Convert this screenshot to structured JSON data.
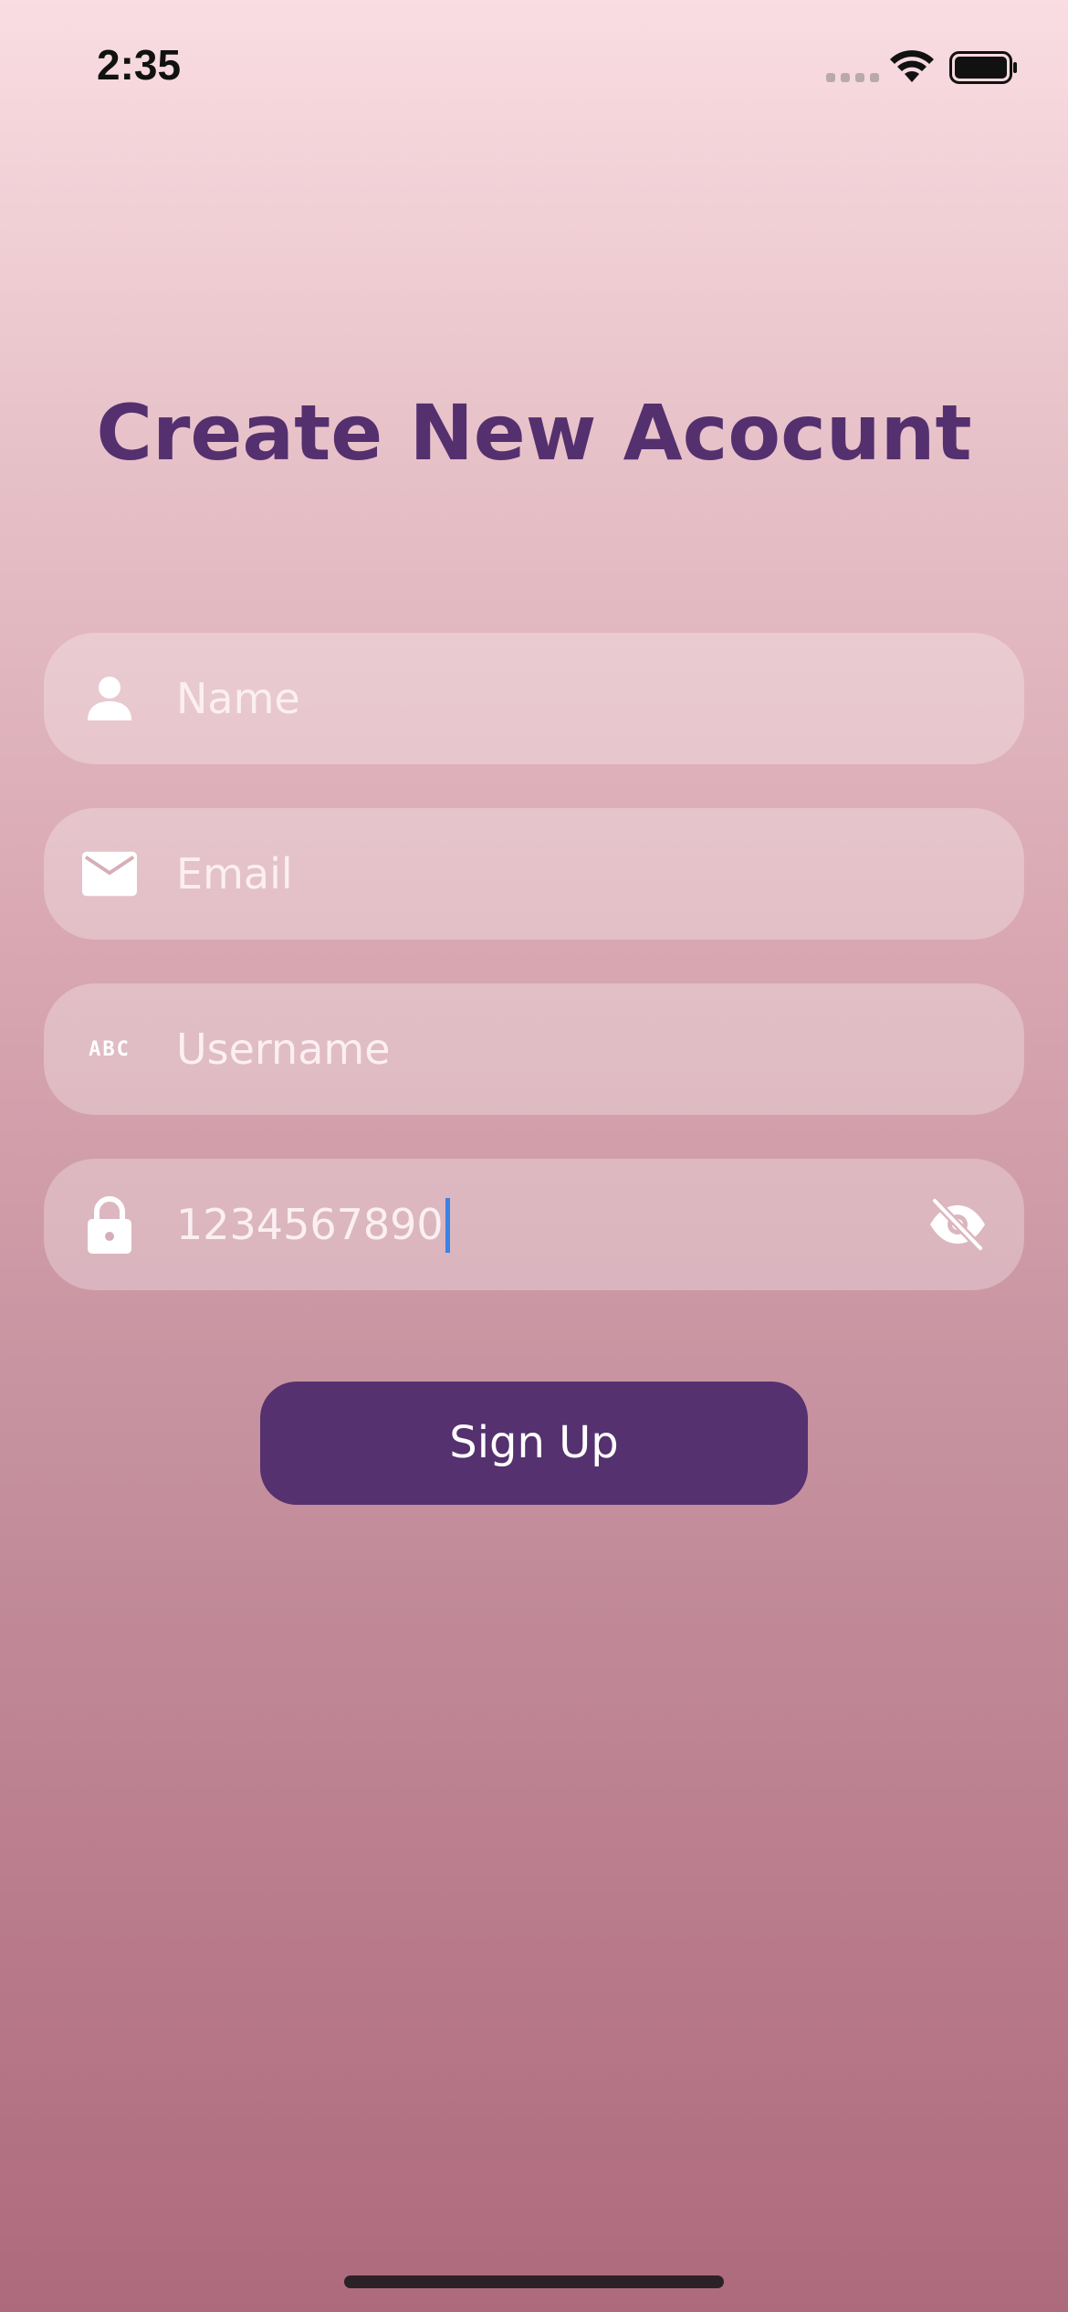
{
  "status_bar": {
    "time": "2:35"
  },
  "title": "Create New Acocunt",
  "form": {
    "name": {
      "placeholder": "Name",
      "icon": "person-icon"
    },
    "email": {
      "placeholder": "Email",
      "icon": "mail-icon"
    },
    "username": {
      "placeholder": "Username",
      "icon": "abc-icon",
      "icon_text": "ABC"
    },
    "password": {
      "value": "1234567890",
      "icon": "lock-icon",
      "toggle_icon": "eye-off-icon"
    }
  },
  "signup_button": {
    "label": "Sign Up"
  },
  "colors": {
    "accent": "#55316f",
    "title": "#55306f",
    "field_text": "#fbeff2",
    "cursor": "#3b82e6"
  }
}
